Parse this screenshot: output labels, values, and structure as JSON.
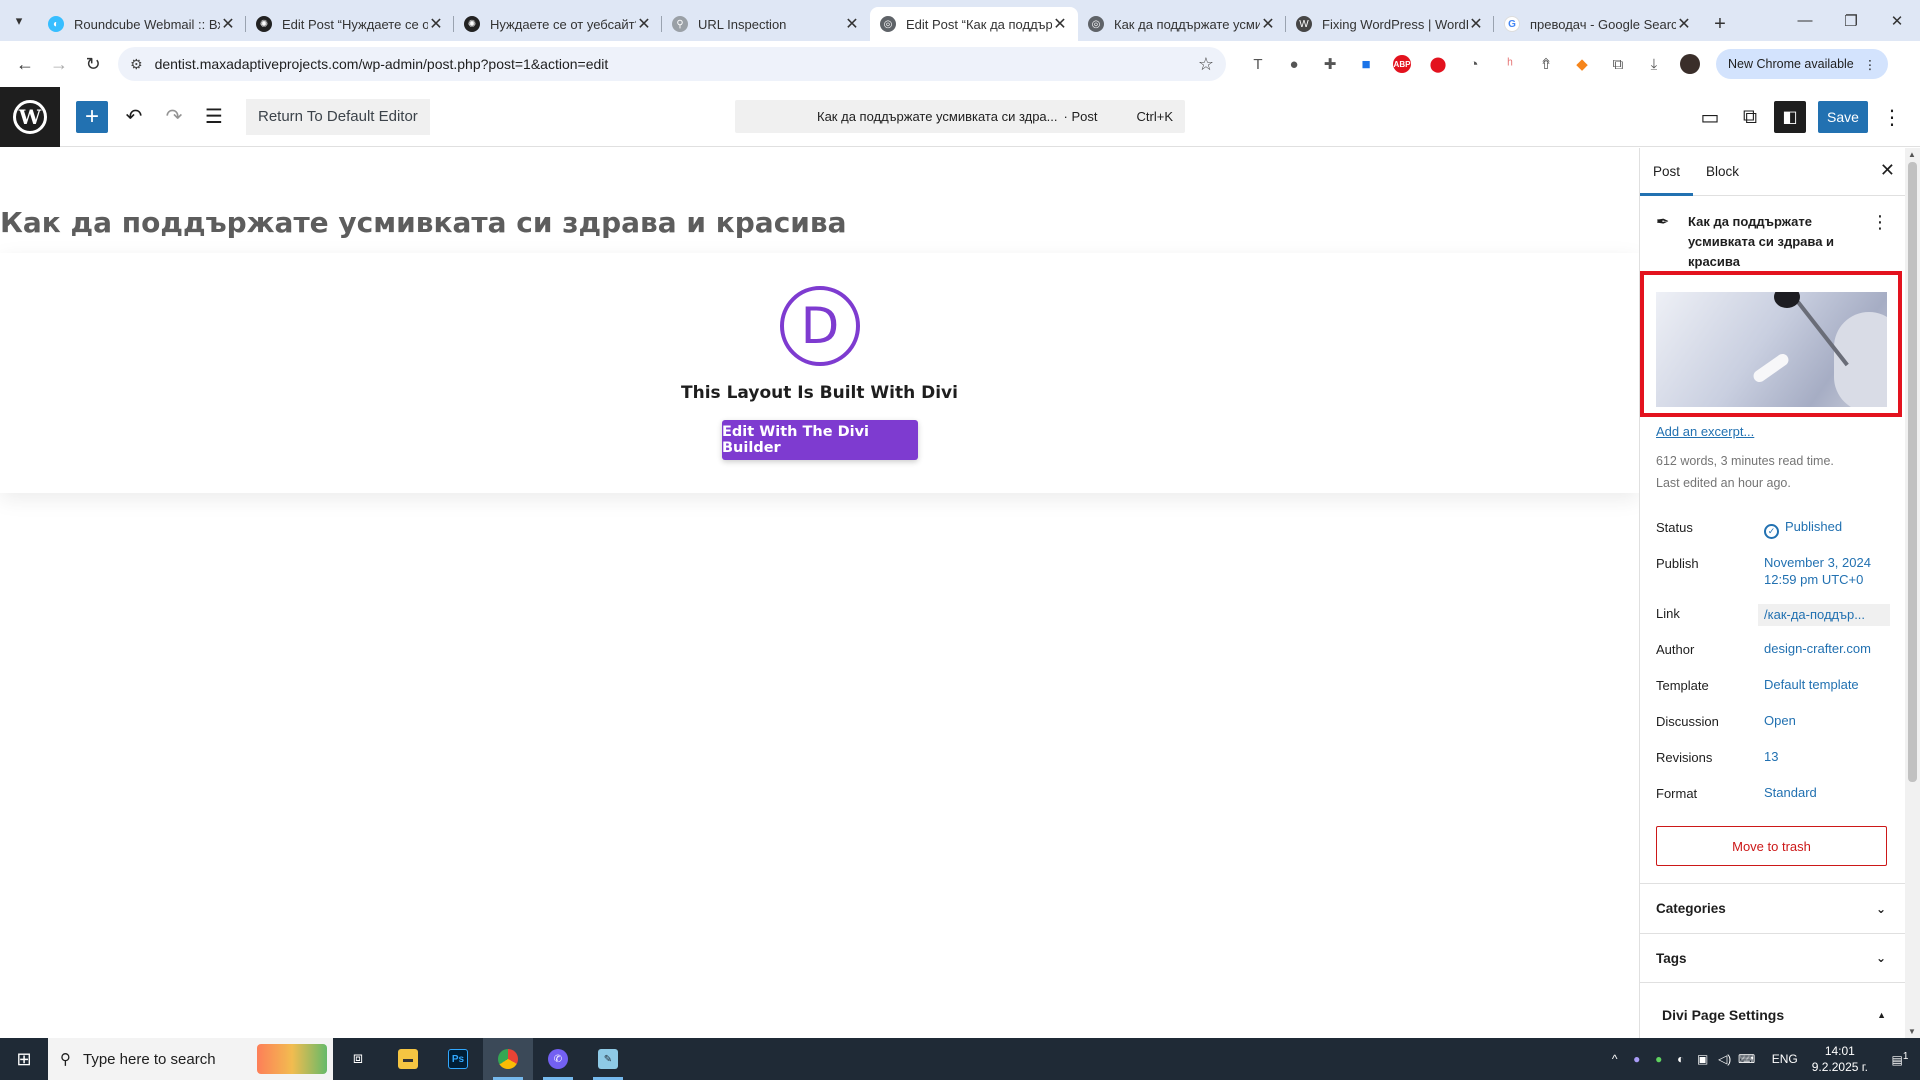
{
  "browser": {
    "tabs": [
      {
        "title": "Roundcube Webmail :: Вх",
        "active": false
      },
      {
        "title": "Edit Post “Нуждаете се от",
        "active": false
      },
      {
        "title": "Нуждаете се от уебсайт?",
        "active": false
      },
      {
        "title": "URL Inspection",
        "active": false
      },
      {
        "title": "Edit Post “Как да поддърж",
        "active": true
      },
      {
        "title": "Как да поддържате усми",
        "active": false
      },
      {
        "title": "Fixing WordPress | WordP",
        "active": false
      },
      {
        "title": "преводач - Google Search",
        "active": false
      }
    ],
    "url": "dentist.maxadaptiveprojects.com/wp-admin/post.php?post=1&action=edit",
    "new_chrome_label": "New Chrome available"
  },
  "wp_header": {
    "return_label": "Return To Default Editor",
    "command_title": "Как да поддържате усмивката си здра...",
    "command_kind": "· Post",
    "command_shortcut": "Ctrl+K",
    "save_label": "Save"
  },
  "editor": {
    "post_title": "Как да поддържате усмивката си здрава и красива",
    "divi_logo_letter": "D",
    "divi_text": "This Layout Is Built With Divi",
    "divi_button": "Edit With The Divi Builder"
  },
  "sidebar": {
    "tab_post": "Post",
    "tab_block": "Block",
    "post_title": "Как да поддържате усмивката си здрава и красива",
    "excerpt_link": "Add an excerpt...",
    "words": "612 words, 3 minutes read time.",
    "last_edited": "Last edited an hour ago.",
    "rows": {
      "status_label": "Status",
      "status_value": "Published",
      "publish_label": "Publish",
      "publish_date": "November 3, 2024",
      "publish_time": "12:59 pm UTC+0",
      "link_label": "Link",
      "link_value": "/как-да-поддър...",
      "author_label": "Author",
      "author_value": "design-crafter.com",
      "template_label": "Template",
      "template_value": "Default template",
      "discussion_label": "Discussion",
      "discussion_value": "Open",
      "revisions_label": "Revisions",
      "revisions_value": "13",
      "format_label": "Format",
      "format_value": "Standard"
    },
    "trash_label": "Move to trash",
    "panel_categories": "Categories",
    "panel_tags": "Tags",
    "divi_settings": "Divi Page Settings"
  },
  "taskbar": {
    "search_placeholder": "Type here to search",
    "language": "ENG",
    "time": "14:01",
    "date": "9.2.2025 г.",
    "notification_count": "1"
  },
  "colors": {
    "wp_blue": "#2271b1",
    "divi_purple": "#7e3bd0",
    "highlight_red": "#e3121e",
    "trash_red": "#cc1818"
  }
}
